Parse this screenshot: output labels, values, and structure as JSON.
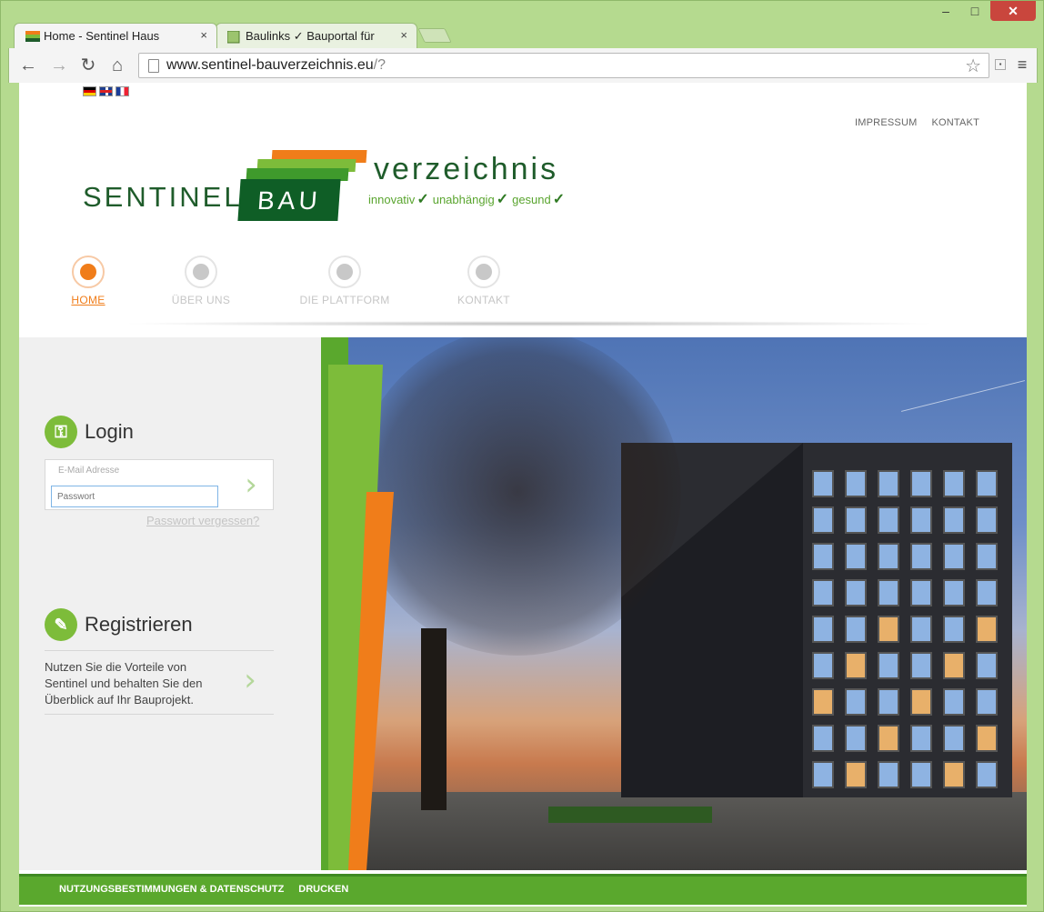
{
  "browser": {
    "tabs": [
      {
        "title": "Home - Sentinel Haus",
        "close": "×"
      },
      {
        "title": "Baulinks ✓ Bauportal für",
        "close": "×"
      }
    ],
    "window_buttons": {
      "minimize": "–",
      "maximize": "□",
      "close": "✕"
    },
    "url": {
      "domain": "www.sentinel-bauverzeichnis.eu",
      "path": "/?"
    },
    "nav": {
      "back": "←",
      "forward": "→",
      "reload": "↻",
      "home": "⌂"
    }
  },
  "page": {
    "top_links": [
      "IMPRESSUM",
      "KONTAKT"
    ],
    "logo": {
      "brand": "SENTINEL",
      "bau": "BAU",
      "verzeichnis": "verzeichnis",
      "slogan": [
        "innovativ",
        "unabhängig",
        "gesund"
      ],
      "check": "✓"
    },
    "nav_items": [
      {
        "label": "HOME",
        "active": true
      },
      {
        "label": "ÜBER UNS",
        "active": false
      },
      {
        "label": "DIE PLATTFORM",
        "active": false
      },
      {
        "label": "KONTAKT",
        "active": false
      }
    ],
    "login": {
      "title": "Login",
      "email_placeholder": "E-Mail Adresse",
      "password_placeholder": "Passwort",
      "forgot": "Passwort vergessen?",
      "submit": "›"
    },
    "register": {
      "title": "Registrieren",
      "text": "Nutzen Sie die Vorteile von Sentinel und behalten Sie den Überblick auf Ihr Bauprojekt.",
      "submit": "›"
    },
    "footer_links": [
      "NUTZUNGSBESTIMMUNGEN & DATENSCHUTZ",
      "DRUCKEN"
    ]
  },
  "colors": {
    "brand_green": "#1f5c2b",
    "accent_green": "#7dbc3a",
    "accent_orange": "#f07d1a",
    "chrome_green": "#b5da8f"
  }
}
